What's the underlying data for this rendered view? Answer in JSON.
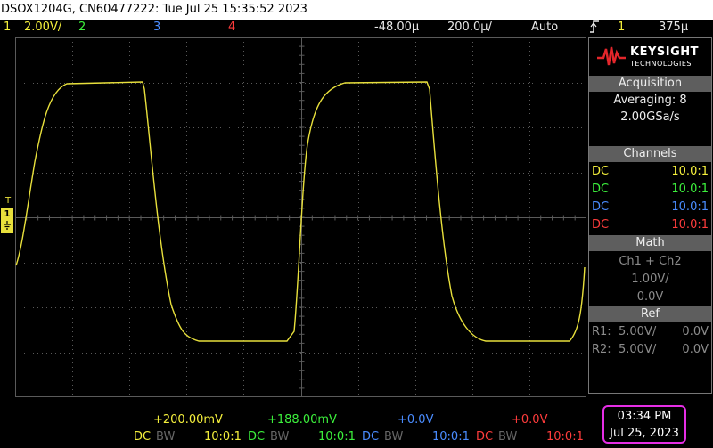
{
  "title_bar": {
    "text": "DSOX1204G, CN60477222: Tue Jul 25 15:35:52 2023"
  },
  "status_bar": {
    "ch1_num": "1",
    "ch1_scale": "2.00V/",
    "ch2_num": "2",
    "ch3_num": "3",
    "ch4_num": "4",
    "delay": "-48.00µ",
    "timebase": "200.0µ/",
    "trigger_mode": "Auto",
    "trigger_icon": "rising-edge-icon",
    "trigger_source": "1",
    "trigger_level": "375µ"
  },
  "ground_marker": {
    "label": "1",
    "top_label": "T"
  },
  "brand": {
    "name": "KEYSIGHT",
    "sub": "TECHNOLOGIES",
    "color": "#e3262b"
  },
  "acquisition": {
    "header": "Acquisition",
    "mode": "Averaging: 8",
    "rate": "2.00GSa/s"
  },
  "channels": {
    "header": "Channels",
    "rows": [
      {
        "coupling": "DC",
        "probe": "10.0:1",
        "color": "#f5f03c"
      },
      {
        "coupling": "DC",
        "probe": "10.0:1",
        "color": "#3cf03c"
      },
      {
        "coupling": "DC",
        "probe": "10.0:1",
        "color": "#4a8cff"
      },
      {
        "coupling": "DC",
        "probe": "10.0:1",
        "color": "#ff3c3c"
      }
    ]
  },
  "math": {
    "header": "Math",
    "expr": "Ch1 + Ch2",
    "scale": "1.00V/",
    "offset": "0.0V"
  },
  "ref": {
    "header": "Ref",
    "rows": [
      {
        "name": "R1:",
        "scale": "5.00V/",
        "offset": "0.0V"
      },
      {
        "name": "R2:",
        "scale": "5.00V/",
        "offset": "0.0V"
      }
    ]
  },
  "bottom_channels": [
    {
      "offset": "+200.00mV",
      "coupling": "DC",
      "bw": "BW",
      "probe": "10:0:1",
      "color": "#f5f03c"
    },
    {
      "offset": "+188.00mV",
      "coupling": "DC",
      "bw": "BW",
      "probe": "10:0:1",
      "color": "#3cf03c"
    },
    {
      "offset": "+0.0V",
      "coupling": "DC",
      "bw": "BW",
      "probe": "10:0:1",
      "color": "#4a8cff"
    },
    {
      "offset": "+0.0V",
      "coupling": "DC",
      "bw": "BW",
      "probe": "10:0:1",
      "color": "#ff3c3c"
    }
  ],
  "clock": {
    "time": "03:34 PM",
    "date": "Jul 25, 2023"
  },
  "colors": {
    "trace": "#e8e03c",
    "grid": "#5a5a5a",
    "highlight": "#e62ee6",
    "trigger_marker": "#ff9a1e"
  }
}
